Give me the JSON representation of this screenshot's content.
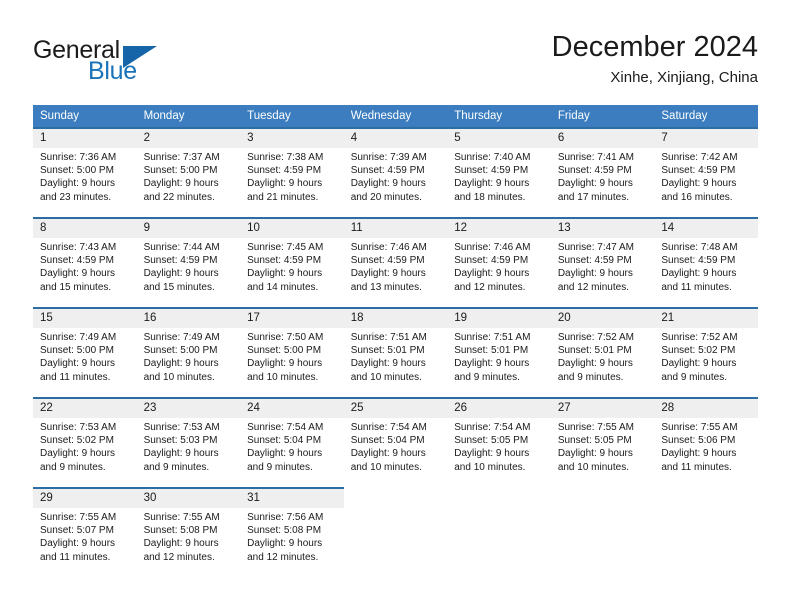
{
  "brand": {
    "word_one": "General",
    "word_two": "Blue",
    "triangle_color": "#1565a8",
    "blue_color": "#1a72b8"
  },
  "header": {
    "title": "December 2024",
    "location": "Xinhe, Xinjiang, China"
  },
  "theme": {
    "header_row_bg": "#3b7dbf",
    "day_number_bg": "#efefef",
    "cell_top_border": "#2e6da4",
    "text_color": "#1b1b1b"
  },
  "weekdays": [
    "Sunday",
    "Monday",
    "Tuesday",
    "Wednesday",
    "Thursday",
    "Friday",
    "Saturday"
  ],
  "labels": {
    "sunrise_prefix": "Sunrise:",
    "sunset_prefix": "Sunset:",
    "daylight_prefix": "Daylight:"
  },
  "weeks": [
    [
      {
        "day": "1",
        "sunrise": "Sunrise: 7:36 AM",
        "sunset": "Sunset: 5:00 PM",
        "daylight_line1": "Daylight: 9 hours",
        "daylight_line2": "and 23 minutes."
      },
      {
        "day": "2",
        "sunrise": "Sunrise: 7:37 AM",
        "sunset": "Sunset: 5:00 PM",
        "daylight_line1": "Daylight: 9 hours",
        "daylight_line2": "and 22 minutes."
      },
      {
        "day": "3",
        "sunrise": "Sunrise: 7:38 AM",
        "sunset": "Sunset: 4:59 PM",
        "daylight_line1": "Daylight: 9 hours",
        "daylight_line2": "and 21 minutes."
      },
      {
        "day": "4",
        "sunrise": "Sunrise: 7:39 AM",
        "sunset": "Sunset: 4:59 PM",
        "daylight_line1": "Daylight: 9 hours",
        "daylight_line2": "and 20 minutes."
      },
      {
        "day": "5",
        "sunrise": "Sunrise: 7:40 AM",
        "sunset": "Sunset: 4:59 PM",
        "daylight_line1": "Daylight: 9 hours",
        "daylight_line2": "and 18 minutes."
      },
      {
        "day": "6",
        "sunrise": "Sunrise: 7:41 AM",
        "sunset": "Sunset: 4:59 PM",
        "daylight_line1": "Daylight: 9 hours",
        "daylight_line2": "and 17 minutes."
      },
      {
        "day": "7",
        "sunrise": "Sunrise: 7:42 AM",
        "sunset": "Sunset: 4:59 PM",
        "daylight_line1": "Daylight: 9 hours",
        "daylight_line2": "and 16 minutes."
      }
    ],
    [
      {
        "day": "8",
        "sunrise": "Sunrise: 7:43 AM",
        "sunset": "Sunset: 4:59 PM",
        "daylight_line1": "Daylight: 9 hours",
        "daylight_line2": "and 15 minutes."
      },
      {
        "day": "9",
        "sunrise": "Sunrise: 7:44 AM",
        "sunset": "Sunset: 4:59 PM",
        "daylight_line1": "Daylight: 9 hours",
        "daylight_line2": "and 15 minutes."
      },
      {
        "day": "10",
        "sunrise": "Sunrise: 7:45 AM",
        "sunset": "Sunset: 4:59 PM",
        "daylight_line1": "Daylight: 9 hours",
        "daylight_line2": "and 14 minutes."
      },
      {
        "day": "11",
        "sunrise": "Sunrise: 7:46 AM",
        "sunset": "Sunset: 4:59 PM",
        "daylight_line1": "Daylight: 9 hours",
        "daylight_line2": "and 13 minutes."
      },
      {
        "day": "12",
        "sunrise": "Sunrise: 7:46 AM",
        "sunset": "Sunset: 4:59 PM",
        "daylight_line1": "Daylight: 9 hours",
        "daylight_line2": "and 12 minutes."
      },
      {
        "day": "13",
        "sunrise": "Sunrise: 7:47 AM",
        "sunset": "Sunset: 4:59 PM",
        "daylight_line1": "Daylight: 9 hours",
        "daylight_line2": "and 12 minutes."
      },
      {
        "day": "14",
        "sunrise": "Sunrise: 7:48 AM",
        "sunset": "Sunset: 4:59 PM",
        "daylight_line1": "Daylight: 9 hours",
        "daylight_line2": "and 11 minutes."
      }
    ],
    [
      {
        "day": "15",
        "sunrise": "Sunrise: 7:49 AM",
        "sunset": "Sunset: 5:00 PM",
        "daylight_line1": "Daylight: 9 hours",
        "daylight_line2": "and 11 minutes."
      },
      {
        "day": "16",
        "sunrise": "Sunrise: 7:49 AM",
        "sunset": "Sunset: 5:00 PM",
        "daylight_line1": "Daylight: 9 hours",
        "daylight_line2": "and 10 minutes."
      },
      {
        "day": "17",
        "sunrise": "Sunrise: 7:50 AM",
        "sunset": "Sunset: 5:00 PM",
        "daylight_line1": "Daylight: 9 hours",
        "daylight_line2": "and 10 minutes."
      },
      {
        "day": "18",
        "sunrise": "Sunrise: 7:51 AM",
        "sunset": "Sunset: 5:01 PM",
        "daylight_line1": "Daylight: 9 hours",
        "daylight_line2": "and 10 minutes."
      },
      {
        "day": "19",
        "sunrise": "Sunrise: 7:51 AM",
        "sunset": "Sunset: 5:01 PM",
        "daylight_line1": "Daylight: 9 hours",
        "daylight_line2": "and 9 minutes."
      },
      {
        "day": "20",
        "sunrise": "Sunrise: 7:52 AM",
        "sunset": "Sunset: 5:01 PM",
        "daylight_line1": "Daylight: 9 hours",
        "daylight_line2": "and 9 minutes."
      },
      {
        "day": "21",
        "sunrise": "Sunrise: 7:52 AM",
        "sunset": "Sunset: 5:02 PM",
        "daylight_line1": "Daylight: 9 hours",
        "daylight_line2": "and 9 minutes."
      }
    ],
    [
      {
        "day": "22",
        "sunrise": "Sunrise: 7:53 AM",
        "sunset": "Sunset: 5:02 PM",
        "daylight_line1": "Daylight: 9 hours",
        "daylight_line2": "and 9 minutes."
      },
      {
        "day": "23",
        "sunrise": "Sunrise: 7:53 AM",
        "sunset": "Sunset: 5:03 PM",
        "daylight_line1": "Daylight: 9 hours",
        "daylight_line2": "and 9 minutes."
      },
      {
        "day": "24",
        "sunrise": "Sunrise: 7:54 AM",
        "sunset": "Sunset: 5:04 PM",
        "daylight_line1": "Daylight: 9 hours",
        "daylight_line2": "and 9 minutes."
      },
      {
        "day": "25",
        "sunrise": "Sunrise: 7:54 AM",
        "sunset": "Sunset: 5:04 PM",
        "daylight_line1": "Daylight: 9 hours",
        "daylight_line2": "and 10 minutes."
      },
      {
        "day": "26",
        "sunrise": "Sunrise: 7:54 AM",
        "sunset": "Sunset: 5:05 PM",
        "daylight_line1": "Daylight: 9 hours",
        "daylight_line2": "and 10 minutes."
      },
      {
        "day": "27",
        "sunrise": "Sunrise: 7:55 AM",
        "sunset": "Sunset: 5:05 PM",
        "daylight_line1": "Daylight: 9 hours",
        "daylight_line2": "and 10 minutes."
      },
      {
        "day": "28",
        "sunrise": "Sunrise: 7:55 AM",
        "sunset": "Sunset: 5:06 PM",
        "daylight_line1": "Daylight: 9 hours",
        "daylight_line2": "and 11 minutes."
      }
    ],
    [
      {
        "day": "29",
        "sunrise": "Sunrise: 7:55 AM",
        "sunset": "Sunset: 5:07 PM",
        "daylight_line1": "Daylight: 9 hours",
        "daylight_line2": "and 11 minutes."
      },
      {
        "day": "30",
        "sunrise": "Sunrise: 7:55 AM",
        "sunset": "Sunset: 5:08 PM",
        "daylight_line1": "Daylight: 9 hours",
        "daylight_line2": "and 12 minutes."
      },
      {
        "day": "31",
        "sunrise": "Sunrise: 7:56 AM",
        "sunset": "Sunset: 5:08 PM",
        "daylight_line1": "Daylight: 9 hours",
        "daylight_line2": "and 12 minutes."
      },
      null,
      null,
      null,
      null
    ]
  ]
}
